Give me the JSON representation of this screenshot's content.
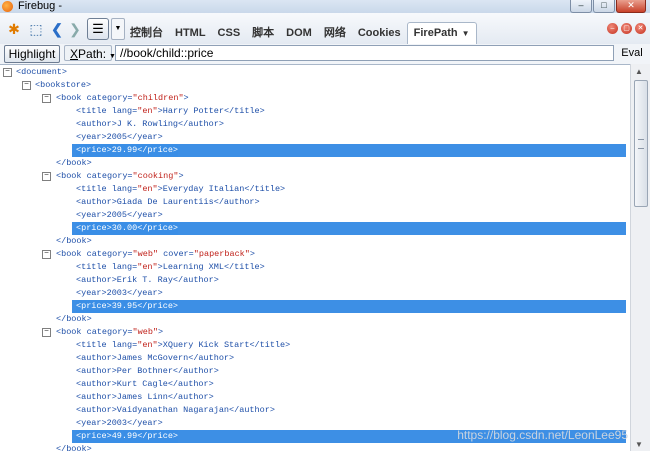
{
  "window": {
    "title": "Firebug -"
  },
  "toolbar": {
    "tabs": [
      {
        "label": "控制台"
      },
      {
        "label": "HTML"
      },
      {
        "label": "CSS"
      },
      {
        "label": "脚本"
      },
      {
        "label": "DOM"
      },
      {
        "label": "网络"
      },
      {
        "label": "Cookies"
      },
      {
        "label": "FirePath"
      }
    ]
  },
  "xpathbar": {
    "highlight_label": "Highlight",
    "xpath_label_first": "X",
    "xpath_label_rest": "Path:",
    "query": "//book/child::price",
    "eval_label": "Eval"
  },
  "tree": {
    "document": "<document>",
    "bookstore_open": "<bookstore>",
    "books": [
      {
        "open_a": "<book ",
        "attr1": "category=",
        "val1": "\"children\"",
        "open_close": ">",
        "title_pre": "<title ",
        "title_attr": "lang=",
        "title_val": "\"en\"",
        "title_text": ">Harry Potter</title>",
        "author": [
          "<author>J K. Rowling</author>"
        ],
        "year": "<year>2005</year>",
        "price": "<price>29.99</price>",
        "close": "</book>"
      },
      {
        "open_a": "<book ",
        "attr1": "category=",
        "val1": "\"cooking\"",
        "open_close": ">",
        "title_pre": "<title ",
        "title_attr": "lang=",
        "title_val": "\"en\"",
        "title_text": ">Everyday Italian</title>",
        "author": [
          "<author>Giada De Laurentiis</author>"
        ],
        "year": "<year>2005</year>",
        "price": "<price>30.00</price>",
        "close": "</book>"
      },
      {
        "open_a": "<book ",
        "attr1": "category=",
        "val1": "\"web\"",
        "attr2": " cover=",
        "val2": "\"paperback\"",
        "open_close": ">",
        "title_pre": "<title ",
        "title_attr": "lang=",
        "title_val": "\"en\"",
        "title_text": ">Learning XML</title>",
        "author": [
          "<author>Erik T. Ray</author>"
        ],
        "year": "<year>2003</year>",
        "price": "<price>39.95</price>",
        "close": "</book>"
      },
      {
        "open_a": "<book ",
        "attr1": "category=",
        "val1": "\"web\"",
        "open_close": ">",
        "title_pre": "<title ",
        "title_attr": "lang=",
        "title_val": "\"en\"",
        "title_text": ">XQuery Kick Start</title>",
        "author": [
          "<author>James McGovern</author>",
          "<author>Per Bothner</author>",
          "<author>Kurt Cagle</author>",
          "<author>James Linn</author>",
          "<author>Vaidyanathan Nagarajan</author>"
        ],
        "year": "<year>2003</year>",
        "price": "<price>49.99</price>",
        "close": "</book>"
      }
    ]
  },
  "watermark": "https://blog.csdn.net/LeonLee95"
}
